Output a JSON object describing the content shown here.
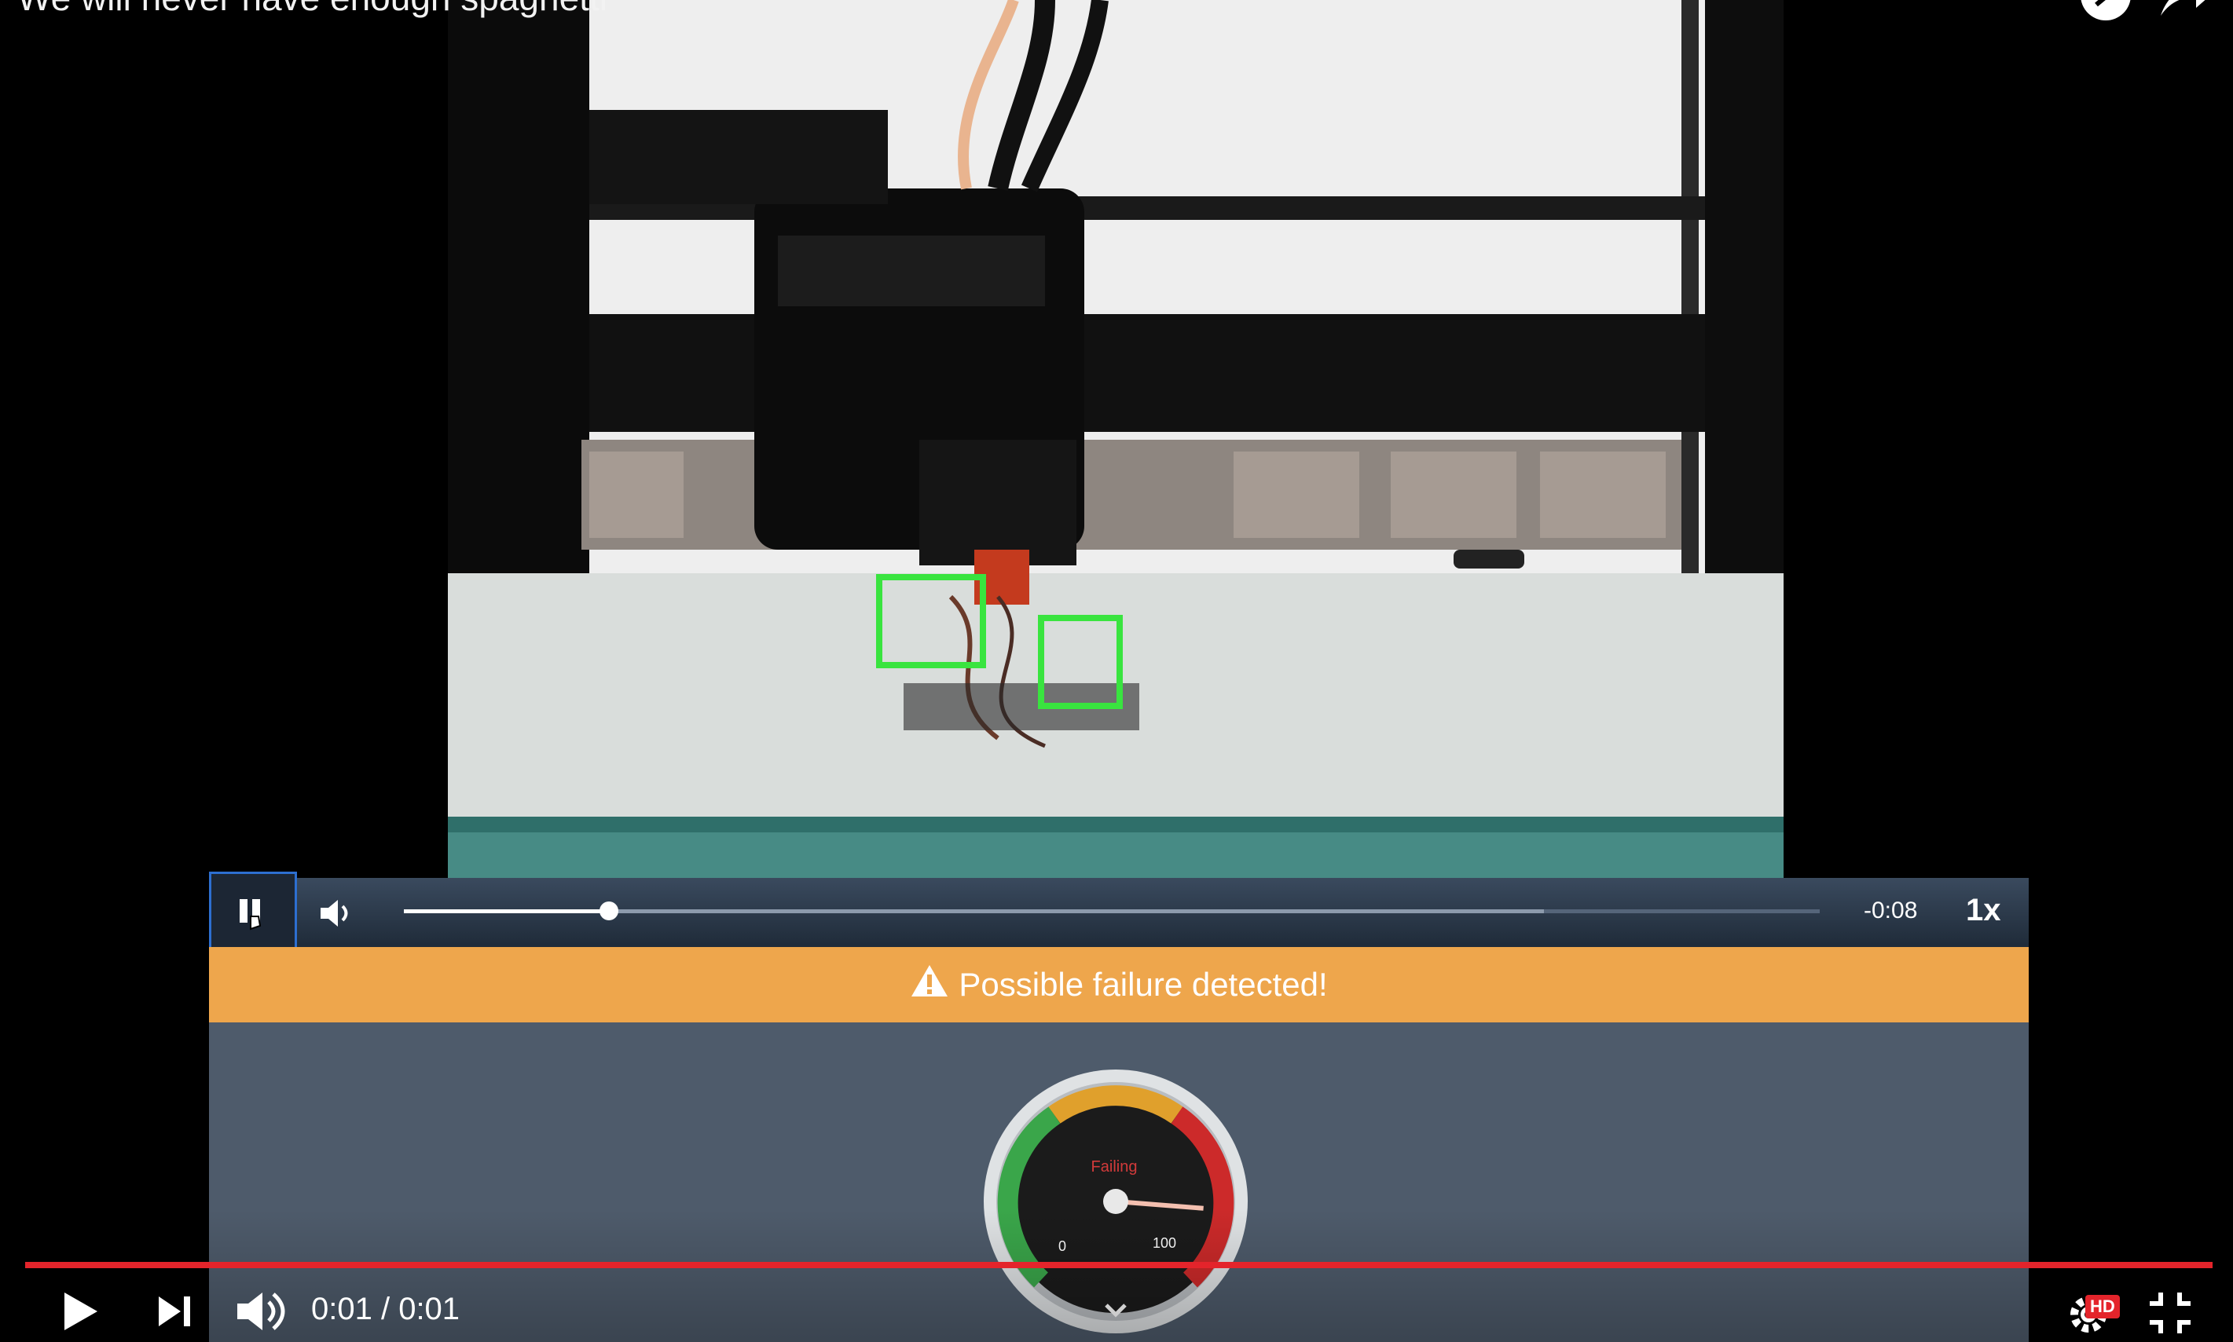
{
  "video": {
    "title": "We will never have enough spaghetti"
  },
  "top_controls": {
    "watch_later_icon": "clock-icon",
    "share_icon": "share-icon"
  },
  "embed_player": {
    "time_remaining": "-0:08",
    "speed": "1x",
    "progress_fraction": 0.145,
    "buffered_fraction": 0.805
  },
  "alert": {
    "icon": "warning-icon",
    "text": "Possible failure detected!",
    "color": "#eea64c"
  },
  "gauge": {
    "label": "Failing",
    "min_label": "0",
    "max_label": "100",
    "value": 85,
    "zones": [
      "#3aa64a",
      "#e0a02c",
      "#cc2a2a"
    ]
  },
  "youtube_controls": {
    "time": "0:01 / 0:01",
    "quality_badge": "HD",
    "progress_color": "#e4242b"
  }
}
